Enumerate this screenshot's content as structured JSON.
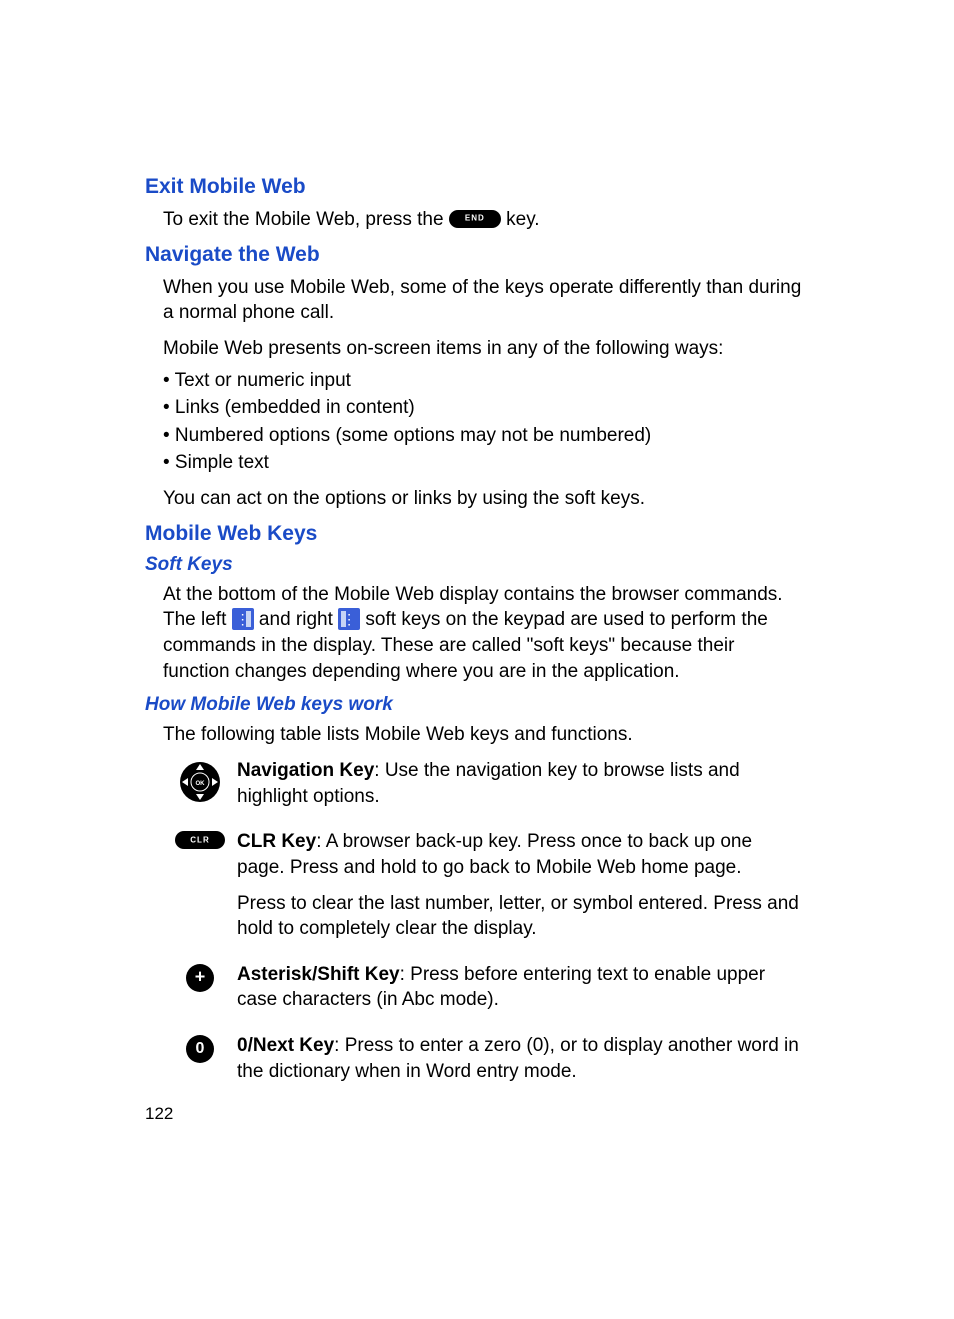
{
  "sections": {
    "exit": {
      "title": "Exit Mobile Web",
      "text_before": "To exit the Mobile Web, press the ",
      "text_after": " key."
    },
    "navigate": {
      "title": "Navigate the Web",
      "p1": "When you use Mobile Web, some of the keys operate differently than during a normal phone call.",
      "p2": "Mobile Web presents on-screen items in any of the following ways:",
      "bullets": [
        "• Text or numeric input",
        "• Links (embedded in content)",
        "• Numbered options (some options may not be numbered)",
        "• Simple text"
      ],
      "p3": "You can act on the options or links by using the soft keys."
    },
    "keys": {
      "title": "Mobile Web Keys",
      "soft": {
        "title": "Soft Keys",
        "t1": "At the bottom of the Mobile Web display contains the browser commands. The left ",
        "t2": " and right ",
        "t3": " soft keys on the keypad are used to perform the commands in the display. These are called \"soft keys\" because their function changes depending where you are in the application."
      },
      "how": {
        "title": "How Mobile Web keys work",
        "intro": "The following table lists Mobile Web keys and functions.",
        "rows": [
          {
            "label": "Navigation Key",
            "desc": ": Use the navigation key to browse lists and highlight options."
          },
          {
            "label": "CLR Key",
            "desc": ": A browser back-up key. Press once to back up one page. Press and hold to go back to Mobile Web home page.",
            "desc2": "Press to clear the last number, letter, or symbol entered. Press and hold to completely clear the display."
          },
          {
            "label": "Asterisk/Shift Key",
            "desc": ": Press before entering text to enable upper case characters (in Abc mode)."
          },
          {
            "label": "0/Next Key",
            "desc": ": Press to enter a zero (0), or to display another word in the dictionary when in Word entry mode."
          }
        ]
      }
    }
  },
  "page_number": "122"
}
